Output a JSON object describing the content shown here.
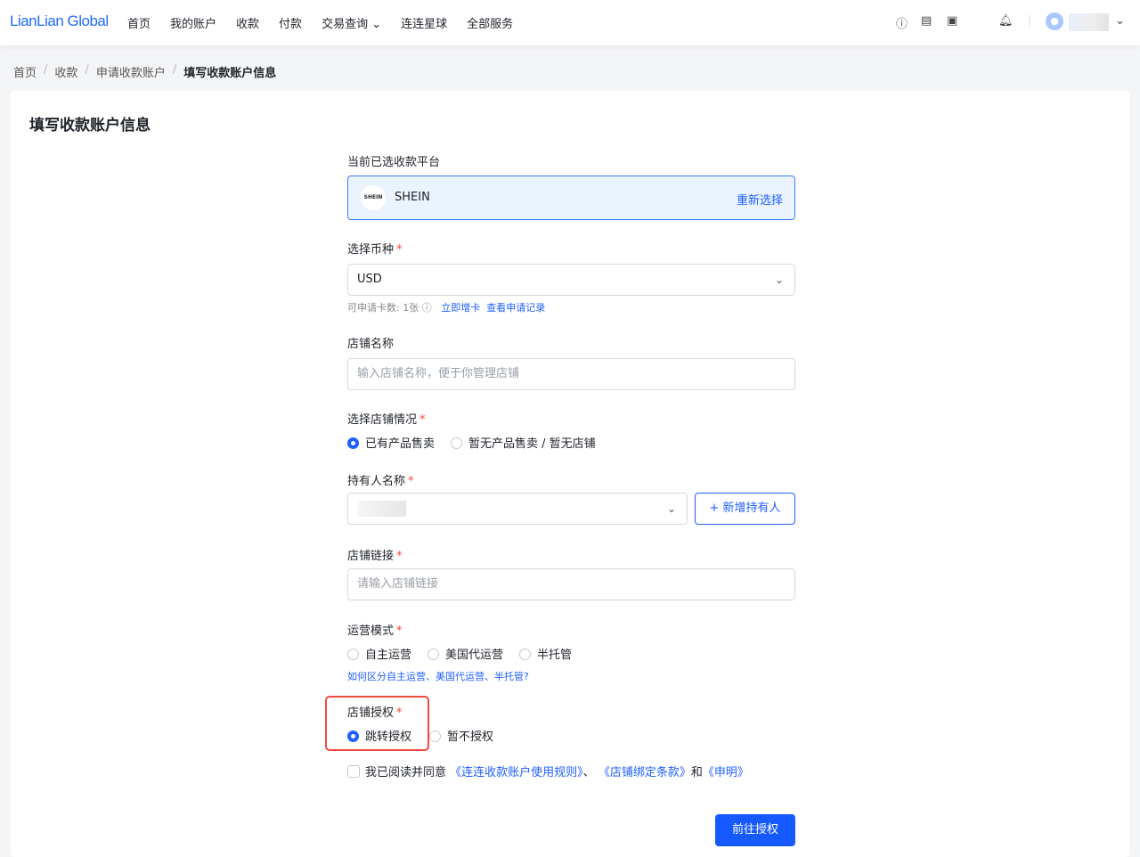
{
  "header": {
    "logo": "LianLian Global",
    "nav": [
      "首页",
      "我的账户",
      "收款",
      "付款",
      "交易查询",
      "连连星球",
      "全部服务"
    ],
    "icons": [
      "help-icon",
      "calendar-icon",
      "gift-icon",
      "bell-icon",
      "user-icon"
    ]
  },
  "breadcrumb": [
    "首页",
    "收款",
    "申请收款账户",
    "填写收款账户信息"
  ],
  "page_title": "填写收款账户信息",
  "platform": {
    "label": "当前已选收款平台",
    "name": "SHEIN",
    "logo_text": "SHEIN",
    "reselect": "重新选择"
  },
  "currency": {
    "label": "选择币种",
    "value": "USD",
    "quota": "可申请卡数: 1张",
    "add_card": "立即增卡",
    "records": "查看申请记录"
  },
  "shop_name": {
    "label": "店铺名称",
    "placeholder": "输入店铺名称，便于你管理店铺"
  },
  "shop_status": {
    "label": "选择店铺情况",
    "options": [
      "已有产品售卖",
      "暂无产品售卖 / 暂无店铺"
    ],
    "selected": 0
  },
  "holder": {
    "label": "持有人名称",
    "add_button": "+ 新增持有人"
  },
  "shop_link": {
    "label": "店铺链接",
    "placeholder": "请输入店铺链接"
  },
  "ops_mode": {
    "label": "运营模式",
    "options": [
      "自主运营",
      "美国代运营",
      "半托管"
    ],
    "help_link": "如何区分自主运营、美国代运营、半托管?"
  },
  "auth": {
    "label": "店铺授权",
    "options": [
      "跳转授权",
      "暂不授权"
    ],
    "selected": 0,
    "highlight_color": "#f04a3e"
  },
  "agree": {
    "prefix": "我已阅读并同意",
    "rule1": "《连连收款账户使用规则》",
    "sep": "、",
    "rule2": "《店铺绑定条款》",
    "and": "和",
    "rule3": "《申明》"
  },
  "submit": "前往授权"
}
